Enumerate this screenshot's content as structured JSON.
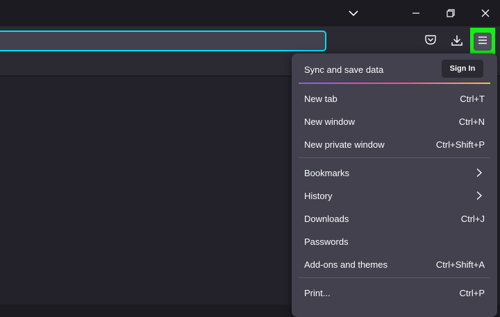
{
  "titlebar": {
    "icons": [
      "chevron-down-icon",
      "minimize-icon",
      "restore-icon",
      "close-icon"
    ]
  },
  "toolbar": {
    "url_value": "",
    "icons": [
      "pocket-icon",
      "download-icon",
      "hamburger-menu-icon"
    ],
    "menu_highlight_color": "#12f112"
  },
  "app_menu": {
    "sync_label": "Sync and save data",
    "sign_in_label": "Sign In",
    "items": [
      {
        "label": "New tab",
        "shortcut": "Ctrl+T"
      },
      {
        "label": "New window",
        "shortcut": "Ctrl+N"
      },
      {
        "label": "New private window",
        "shortcut": "Ctrl+Shift+P"
      },
      {
        "label": "Bookmarks",
        "shortcut": ""
      },
      {
        "label": "History",
        "shortcut": ""
      },
      {
        "label": "Downloads",
        "shortcut": "Ctrl+J"
      },
      {
        "label": "Passwords",
        "shortcut": ""
      },
      {
        "label": "Add-ons and themes",
        "shortcut": "Ctrl+Shift+A"
      },
      {
        "label": "Print...",
        "shortcut": "Ctrl+P"
      }
    ]
  },
  "colors": {
    "accent_focus": "#00ddff",
    "panel_bg": "#42414d",
    "toolbar_bg": "#2b2a33"
  }
}
